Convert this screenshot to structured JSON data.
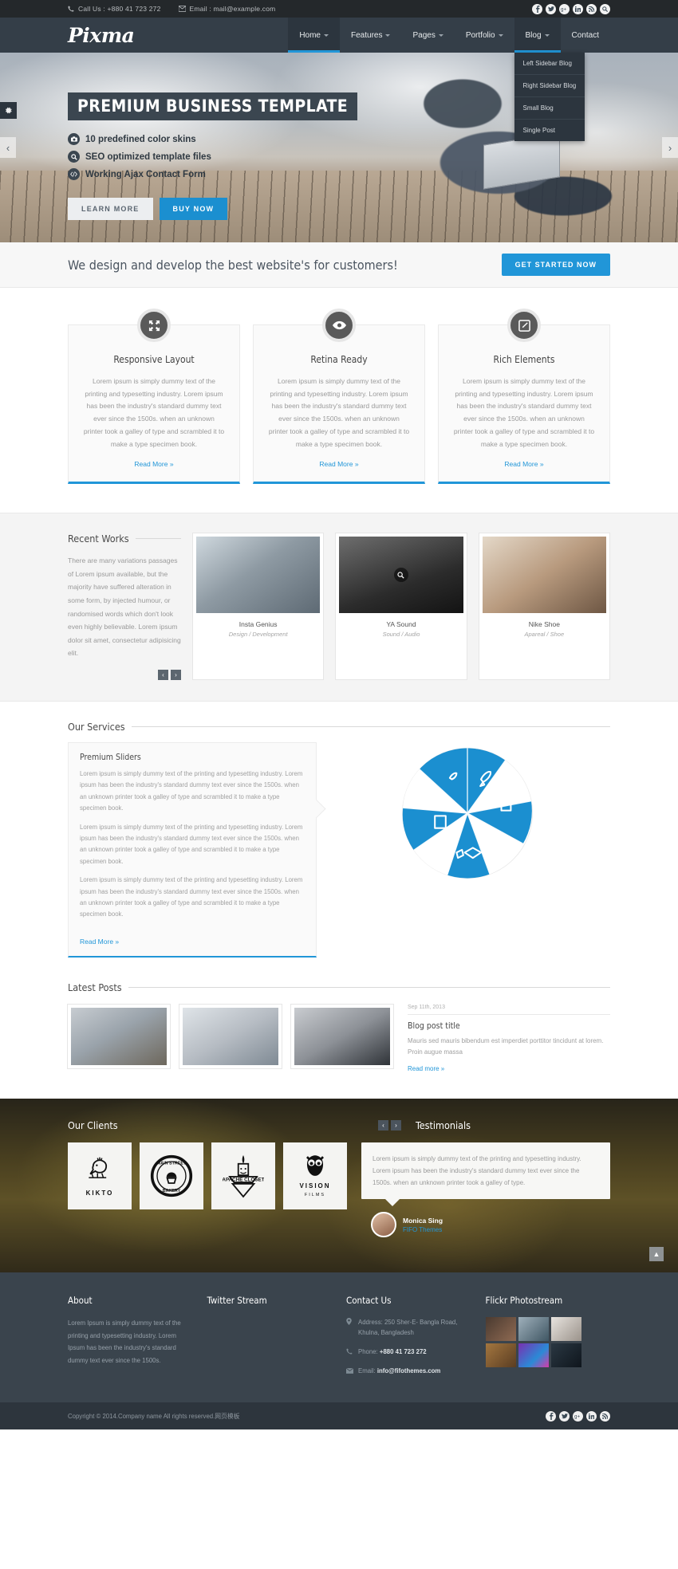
{
  "topbar": {
    "phone_label": "Call Us : +880 41 723 272",
    "email_label": "Email : mail@example.com",
    "social": [
      "facebook-icon",
      "twitter-icon",
      "google-plus-icon",
      "linkedin-icon",
      "rss-icon",
      "search-icon"
    ]
  },
  "nav": {
    "logo": "Pixma",
    "items": [
      {
        "label": "Home",
        "has_caret": true,
        "active": true
      },
      {
        "label": "Features",
        "has_caret": true,
        "active": false
      },
      {
        "label": "Pages",
        "has_caret": true,
        "active": false
      },
      {
        "label": "Portfolio",
        "has_caret": true,
        "active": false
      },
      {
        "label": "Blog",
        "has_caret": true,
        "active": false,
        "open": true
      },
      {
        "label": "Contact",
        "has_caret": false,
        "active": false
      }
    ],
    "dropdown": [
      "Left Sidebar Blog",
      "Right Sidebar Blog",
      "Small Blog",
      "Single Post"
    ]
  },
  "hero": {
    "title": "PREMIUM BUSINESS TEMPLATE",
    "bullets": [
      {
        "icon": "camera-icon",
        "text": "10 predefined color skins"
      },
      {
        "icon": "search-icon",
        "text": "SEO optimized template files"
      },
      {
        "icon": "code-icon",
        "text": "Working Ajax Contact Form"
      }
    ],
    "btn_learn": "LEARN MORE",
    "btn_buy": "BUY NOW",
    "prev": "‹",
    "next": "›"
  },
  "cta": {
    "text": "We design and develop the best website's for customers!",
    "button": "GET STARTED NOW"
  },
  "features": [
    {
      "icon": "expand-arrows-icon",
      "title": "Responsive Layout",
      "body": "Lorem ipsum is simply dummy text of the printing and typesetting industry. Lorem ipsum has been the industry's standard dummy text ever since the 1500s. when an unknown printer took a galley of type and scrambled it to make a type specimen book.",
      "link": "Read More »"
    },
    {
      "icon": "eye-icon",
      "title": "Retina Ready",
      "body": "Lorem ipsum is simply dummy text of the printing and typesetting industry. Lorem ipsum has been the industry's standard dummy text ever since the 1500s. when an unknown printer took a galley of type and scrambled it to make a type specimen book.",
      "link": "Read More »"
    },
    {
      "icon": "pencil-square-icon",
      "title": "Rich Elements",
      "body": "Lorem ipsum is simply dummy text of the printing and typesetting industry. Lorem ipsum has been the industry's standard dummy text ever since the 1500s. when an unknown printer took a galley of type and scrambled it to make a type specimen book.",
      "link": "Read More »"
    }
  ],
  "works": {
    "title": "Recent Works",
    "description": "There are many variations passages of Lorem ipsum available, but the majority have suffered alteration in some form, by injected humour, or randomised words which don't look even highly believable. Lorem ipsum dolor sit amet, consectetur adipisicing elit.",
    "prev": "‹",
    "next": "›",
    "items": [
      {
        "name": "Insta Genius",
        "category": "Design / Development"
      },
      {
        "name": "YA Sound",
        "category": "Sound / Audio"
      },
      {
        "name": "Nike Shoe",
        "category": "Apareal / Shoe"
      }
    ]
  },
  "services": {
    "title": "Our Services",
    "box_title": "Premium Sliders",
    "paragraphs": [
      "Lorem ipsum is simply dummy text of the printing and typesetting industry. Lorem ipsum has been the industry's standard dummy text ever since the 1500s. when an unknown printer took a galley of type and scrambled it to make a type specimen book.",
      "Lorem ipsum is simply dummy text of the printing and typesetting industry. Lorem ipsum has been the industry's standard dummy text ever since the 1500s. when an unknown printer took a galley of type and scrambled it to make a type specimen book.",
      "Lorem ipsum is simply dummy text of the printing and typesetting industry. Lorem ipsum has been the industry's standard dummy text ever since the 1500s. when an unknown printer took a galley of type and scrambled it to make a type specimen book."
    ],
    "link": "Read More »",
    "wheel_color": "#1b8fd0",
    "wheel_segments": 10
  },
  "posts": {
    "title": "Latest Posts",
    "date": "Sep 11th, 2013",
    "post_title": "Blog post title",
    "excerpt": "Mauris sed mauris bibendum est imperdiet porttitor tincidunt at lorem. Proin augue massa",
    "link": "Read more »"
  },
  "clients": {
    "title": "Our Clients",
    "prev": "‹",
    "next": "›",
    "logos": [
      {
        "name": "KIKTO",
        "sub": "",
        "mark": "bird-icon"
      },
      {
        "name": "MAIN STREET",
        "sub": "BAKERY",
        "mark": "cupcake-badge-icon"
      },
      {
        "name": "APACHE CLOSET",
        "sub": "",
        "mark": "paintbrush-icon"
      },
      {
        "name": "VISION",
        "sub": "FILMS",
        "mark": "owl-icon"
      }
    ]
  },
  "testimonials": {
    "title": "Testimonials",
    "quote": "Lorem ipsum is simply dummy text of the printing and typesetting industry. Lorem ipsum has been the industry's standard dummy text ever since the 1500s. when an unknown printer took a galley of type.",
    "author": "Monica Sing",
    "role": "FIFO Themes",
    "scroll_top": "▲"
  },
  "footer": {
    "about": {
      "title": "About",
      "text": "Lorem Ipsum is simply dummy text of the printing and typesetting industry. Lorem Ipsum has been the industry's standard dummy text ever since the 1500s."
    },
    "twitter": {
      "title": "Twitter Stream"
    },
    "contact": {
      "title": "Contact Us",
      "address_label": "Address:",
      "address_line1": "250 Sher-E- Bangla Road,",
      "address_line2": "Khulna, Bangladesh",
      "phone_label": "Phone:",
      "phone_value": "+880 41 723 272",
      "email_label": "Email:",
      "email_value": "info@fifothemes.com"
    },
    "flickr": {
      "title": "Flickr Photostream",
      "count": 6
    },
    "copyright": "Copyright © 2014.Company name All rights reserved.网页模板",
    "social": [
      "facebook-icon",
      "twitter-icon",
      "google-plus-icon",
      "linkedin-icon",
      "rss-icon"
    ]
  }
}
